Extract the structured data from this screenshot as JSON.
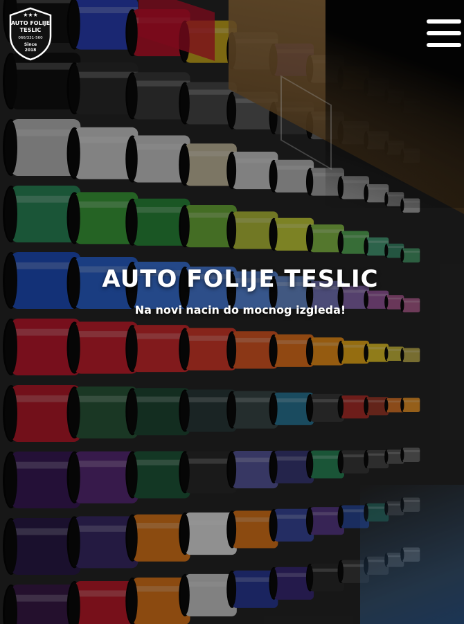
{
  "logo": {
    "line1": "AUTO FOLIJE",
    "line2": "TESLIC",
    "phone": "066/331-560",
    "since": "Since",
    "year": "2018",
    "stars": "★★★"
  },
  "menu": {
    "icon": "hamburger-menu-icon"
  },
  "hero": {
    "title": "AUTO FOLIJE TESLIC",
    "subtitle": "Na novi nacin do mocnog izgleda!",
    "background": "wall-of-vinyl-wrap-rolls-photo"
  },
  "colors": {
    "accent": "#ffffff",
    "overlay": "rgba(0,0,0,0.38)"
  }
}
